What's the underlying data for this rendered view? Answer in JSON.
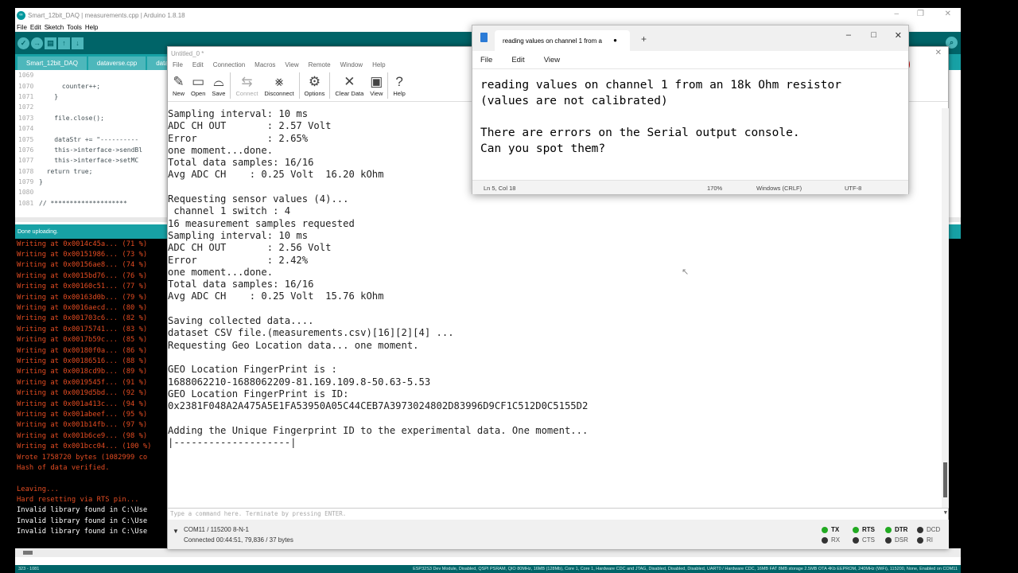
{
  "arduino": {
    "title": "Smart_12bit_DAQ | measurements.cpp | Arduino 1.8.18",
    "menu": [
      "File",
      "Edit",
      "Sketch",
      "Tools",
      "Help"
    ],
    "tabs": [
      "Smart_12bit_DAQ",
      "dataverse.cpp",
      "data"
    ],
    "code_lines": [
      {
        "n": "1069",
        "t": ""
      },
      {
        "n": "1070",
        "t": "      counter++;"
      },
      {
        "n": "1071",
        "t": "    }"
      },
      {
        "n": "1072",
        "t": ""
      },
      {
        "n": "1073",
        "t": "    file.close();"
      },
      {
        "n": "1074",
        "t": ""
      },
      {
        "n": "1075",
        "t": "    dataStr += \"----------"
      },
      {
        "n": "1076",
        "t": "    this->interface->sendBl"
      },
      {
        "n": "1077",
        "t": "    this->interface->setMC"
      },
      {
        "n": "1078",
        "t": "  return true;"
      },
      {
        "n": "1079",
        "t": "}"
      },
      {
        "n": "1080",
        "t": ""
      },
      {
        "n": "1081",
        "t": "// ********************"
      }
    ],
    "status": "Done uploading.",
    "console_lines": [
      {
        "c": "red",
        "t": "Writing at 0x0014c45a... (71 %)"
      },
      {
        "c": "red",
        "t": "Writing at 0x00151986... (73 %)"
      },
      {
        "c": "red",
        "t": "Writing at 0x00156ae8... (74 %)"
      },
      {
        "c": "red",
        "t": "Writing at 0x0015bd76... (76 %)"
      },
      {
        "c": "red",
        "t": "Writing at 0x00160c51... (77 %)"
      },
      {
        "c": "red",
        "t": "Writing at 0x00163d0b... (79 %)"
      },
      {
        "c": "red",
        "t": "Writing at 0x0016aecd... (80 %)"
      },
      {
        "c": "red",
        "t": "Writing at 0x001703c6... (82 %)"
      },
      {
        "c": "red",
        "t": "Writing at 0x00175741... (83 %)"
      },
      {
        "c": "red",
        "t": "Writing at 0x0017b59c... (85 %)"
      },
      {
        "c": "red",
        "t": "Writing at 0x00180f0a... (86 %)"
      },
      {
        "c": "red",
        "t": "Writing at 0x00186516... (88 %)"
      },
      {
        "c": "red",
        "t": "Writing at 0x0018cd9b... (89 %)"
      },
      {
        "c": "red",
        "t": "Writing at 0x0019545f... (91 %)"
      },
      {
        "c": "red",
        "t": "Writing at 0x0019d5bd... (92 %)"
      },
      {
        "c": "red",
        "t": "Writing at 0x001a413c... (94 %)"
      },
      {
        "c": "red",
        "t": "Writing at 0x001abeef... (95 %)"
      },
      {
        "c": "red",
        "t": "Writing at 0x001b14fb... (97 %)"
      },
      {
        "c": "red",
        "t": "Writing at 0x001b6ce9... (98 %)"
      },
      {
        "c": "red",
        "t": "Writing at 0x001bcc04... (100 %)"
      },
      {
        "c": "red",
        "t": "Wrote 1758720 bytes (1082999 co"
      },
      {
        "c": "red",
        "t": "Hash of data verified."
      },
      {
        "c": "red",
        "t": ""
      },
      {
        "c": "red",
        "t": "Leaving..."
      },
      {
        "c": "red",
        "t": "Hard resetting via RTS pin..."
      },
      {
        "c": "wht",
        "t": "Invalid library found in C:\\Use"
      },
      {
        "c": "wht",
        "t": "Invalid library found in C:\\Use"
      },
      {
        "c": "wht",
        "t": "Invalid library found in C:\\Use"
      }
    ],
    "bottom_left": "323 - 1081",
    "bottom_right": "ESP32S3 Dev Module, Disabled, QSPI PSRAM, QIO 80MHz, 16MB (128Mb), Core 1, Core 1, Hardware CDC and JTAG, Disabled, Disabled, Disabled, UART0 / Hardware CDC, 16MB FAT 8MB storage 2.5MB OTA 4Kb EEPROM, 240MHz (WiFi), 115200, None, Enabled on COM11"
  },
  "serial": {
    "title": "Untitled_0 *",
    "menu": [
      "File",
      "Edit",
      "Connection",
      "Macros",
      "View",
      "Remote",
      "Window",
      "Help"
    ],
    "toolbar": {
      "new": "New",
      "open": "Open",
      "save": "Save",
      "connect": "Connect",
      "disconnect": "Disconnect",
      "options": "Options",
      "clear": "Clear Data",
      "view": "View",
      "help": "Help"
    },
    "output": [
      "Sampling interval: 10 ms",
      "ADC CH OUT       : 2.57 Volt",
      "Error            : 2.65%",
      "one moment...done.",
      "Total data samples: 16/16",
      "Avg ADC CH    : 0.25 Volt  16.20 kOhm",
      "",
      "Requesting sensor values (4)...",
      " channel 1 switch : 4",
      "16 measurement samples requested",
      "Sampling interval: 10 ms",
      "ADC CH OUT       : 2.56 Volt",
      "Error            : 2.42%",
      "one moment...done.",
      "Total data samples: 16/16",
      "Avg ADC CH    : 0.25 Volt  15.76 kOhm",
      "",
      "Saving collected data....",
      "dataset CSV file.(measurements.csv)[16][2][4] ...",
      "Requesting Geo Location data... one moment.",
      "",
      "GEO Location FingerPrint is :",
      "1688062210-1688062209-81.169.109.8-50.63-5.53",
      "GEO Location FingerPrint is ID:",
      "0x2381F048A2A475A5E1FA53950A05C44CEB7A3973024802D83996D9CF1C512D0C5155D2",
      "",
      "Adding the Unique Fingerprint ID to the experimental data. One moment...",
      "|--------------------|"
    ],
    "command_placeholder": "Type a command here. Terminate by pressing ENTER.",
    "port": "COM11 / 115200 8-N-1",
    "connected": "Connected 00:44:51, 79,836 / 37 bytes",
    "leds": {
      "tx": "TX",
      "rx": "RX",
      "rts": "RTS",
      "cts": "CTS",
      "dtr": "DTR",
      "dsr": "DSR",
      "dcd": "DCD",
      "ri": "RI"
    }
  },
  "notepad": {
    "tab_title": "reading values on channel 1 from a",
    "menu": [
      "File",
      "Edit",
      "View"
    ],
    "lines": [
      "reading values on channel 1 from an 18k Ohm resistor",
      "(values are not calibrated)",
      "",
      "There are errors on the Serial output console.",
      "Can you spot them?"
    ],
    "status": {
      "position": "Ln 5, Col 18",
      "zoom": "170%",
      "eol": "Windows (CRLF)",
      "encoding": "UTF-8"
    }
  },
  "colors": {
    "arduino_teal": "#006468",
    "arduino_tab": "#17a1a5",
    "console_red": "#e34c22",
    "led_on": "#22aa22"
  }
}
